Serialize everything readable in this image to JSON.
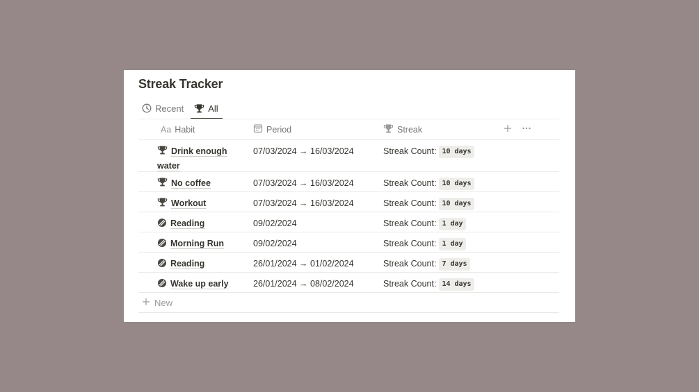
{
  "title": "Streak Tracker",
  "tabs": [
    {
      "label": "Recent",
      "icon": "clock-icon"
    },
    {
      "label": "All",
      "icon": "trophy-icon"
    }
  ],
  "columns": {
    "habit": {
      "label": "Habit",
      "prefix": "Aa"
    },
    "period": {
      "label": "Period",
      "icon": "calendar-icon"
    },
    "streak": {
      "label": "Streak",
      "icon": "trophy-icon"
    }
  },
  "rows": [
    {
      "icon": "trophy-icon",
      "habit": "Drink enough water",
      "period": "07/03/2024 → 16/03/2024",
      "streak_label": "Streak Count:",
      "streak": "10 days"
    },
    {
      "icon": "trophy-icon",
      "habit": "No coffee",
      "period": "07/03/2024 → 16/03/2024",
      "streak_label": "Streak Count:",
      "streak": "10 days"
    },
    {
      "icon": "trophy-icon",
      "habit": "Workout",
      "period": "07/03/2024 → 16/03/2024",
      "streak_label": "Streak Count:",
      "streak": "10 days"
    },
    {
      "icon": "broken-circle-icon",
      "habit": "Reading",
      "period": "09/02/2024",
      "streak_label": "Streak Count:",
      "streak": "1 day"
    },
    {
      "icon": "broken-circle-icon",
      "habit": "Morning Run",
      "period": "09/02/2024",
      "streak_label": "Streak Count:",
      "streak": "1 day"
    },
    {
      "icon": "broken-circle-icon",
      "habit": "Reading",
      "period": "26/01/2024 → 01/02/2024",
      "streak_label": "Streak Count:",
      "streak": "7 days"
    },
    {
      "icon": "broken-circle-icon",
      "habit": "Wake up early",
      "period": "26/01/2024 → 08/02/2024",
      "streak_label": "Streak Count:",
      "streak": "14 days"
    }
  ],
  "new_label": "New",
  "colors": {
    "background": "#968888",
    "panel": "#ffffff",
    "text": "#37352f",
    "muted": "#787774",
    "badge": "#eeedea"
  }
}
